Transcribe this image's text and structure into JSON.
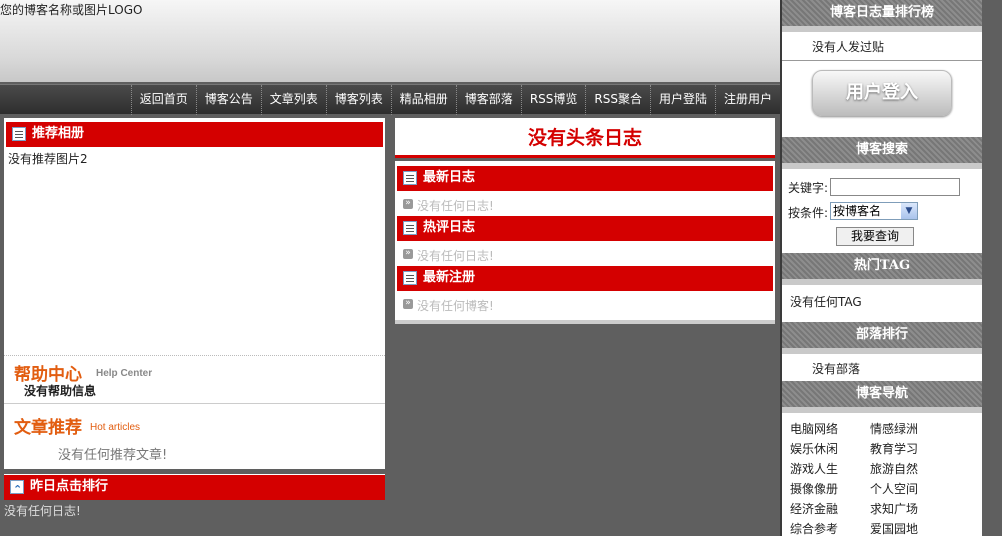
{
  "header": {
    "logo_text": "您的博客名称或图片LOGO"
  },
  "nav": {
    "items": [
      "返回首页",
      "博客公告",
      "文章列表",
      "博客列表",
      "精品相册",
      "博客部落",
      "RSS博览",
      "RSS聚合",
      "用户登陆",
      "注册用户"
    ]
  },
  "left": {
    "recommend_album": {
      "title": "推荐相册",
      "text": "没有推荐图片2"
    },
    "help": {
      "title_cn": "帮助中心",
      "title_en": "Help Center",
      "text": "没有帮助信息"
    },
    "articles": {
      "title_cn": "文章推荐",
      "title_en": "Hot articles",
      "text": "没有任何推荐文章!"
    },
    "yesterday": {
      "title": "昨日点击排行",
      "text": "没有任何日志!"
    }
  },
  "middle": {
    "headline": "没有头条日志",
    "latest_logs": {
      "title": "最新日志",
      "text": "没有任何日志!"
    },
    "hot_comments": {
      "title": "热评日志",
      "text": "没有任何日志!"
    },
    "latest_register": {
      "title": "最新注册",
      "text": "没有任何博客!"
    }
  },
  "right": {
    "ranking": {
      "title": "博客日志量排行榜",
      "text": "没有人发过贴"
    },
    "login_button": "用户登入",
    "search": {
      "title": "博客搜索",
      "keyword_label": "关键字:",
      "keyword_value": "",
      "condition_label": "按条件:",
      "condition_selected": "按博客名",
      "button": "我要查询"
    },
    "hot_tag": {
      "title": "热门TAG",
      "text": "没有任何TAG"
    },
    "tribe": {
      "title": "部落排行",
      "text": "没有部落"
    },
    "blog_nav": {
      "title": "博客导航",
      "categories": [
        "电脑网络",
        "情感绿洲",
        "娱乐休闲",
        "教育学习",
        "游戏人生",
        "旅游自然",
        "摄像像册",
        "个人空间",
        "经济金融",
        "求知广场",
        "综合参考",
        "爱国园地"
      ]
    }
  }
}
